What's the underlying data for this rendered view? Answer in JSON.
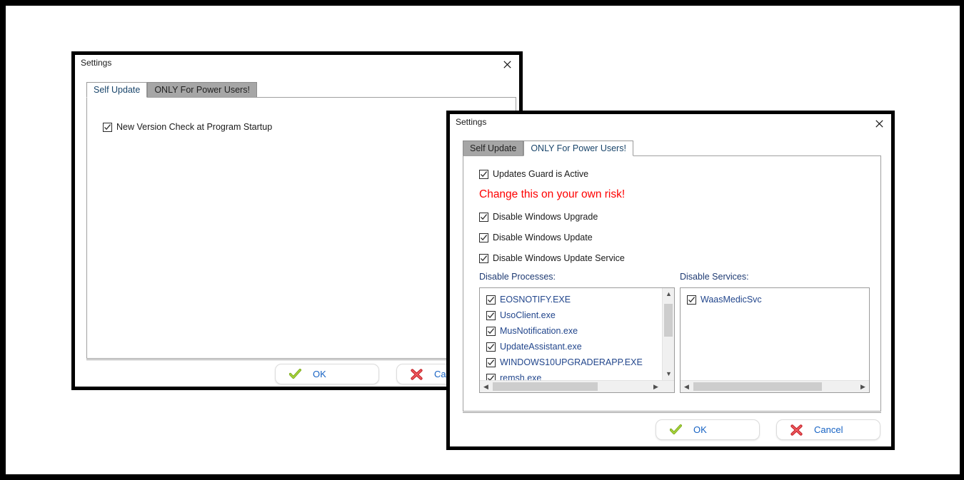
{
  "app": {
    "window_title": "Settings"
  },
  "dialog_self_update": {
    "title": "Settings",
    "close_icon": "close-icon",
    "tabs": [
      {
        "label": "Self Update",
        "active": true
      },
      {
        "label": "ONLY For Power Users!",
        "active": false
      }
    ],
    "options": [
      {
        "label": "New Version Check at Program Startup",
        "checked": true
      }
    ],
    "buttons": [
      {
        "label": "OK",
        "icon": "green-check-icon"
      },
      {
        "label": "Cancel",
        "icon": "red-x-icon"
      }
    ]
  },
  "dialog_power_users": {
    "title": "Settings",
    "close_icon": "close-icon",
    "tabs": [
      {
        "label": "Self Update",
        "active": false
      },
      {
        "label": "ONLY For Power Users!",
        "active": true
      }
    ],
    "guard_option": {
      "label": "Updates Guard is Active",
      "checked": true
    },
    "warning": "Change this on your own risk!",
    "toggles": [
      {
        "label": "Disable Windows Upgrade",
        "checked": true
      },
      {
        "label": "Disable Windows Update",
        "checked": true
      },
      {
        "label": "Disable Windows Update Service",
        "checked": true
      }
    ],
    "processes": {
      "label": "Disable Processes:",
      "items": [
        {
          "label": "EOSNOTIFY.EXE",
          "checked": true
        },
        {
          "label": "UsoClient.exe",
          "checked": true
        },
        {
          "label": "MusNotification.exe",
          "checked": true
        },
        {
          "label": "UpdateAssistant.exe",
          "checked": true
        },
        {
          "label": "WINDOWS10UPGRADERAPP.EXE",
          "checked": true
        },
        {
          "label": "remsh.exe",
          "checked": true
        }
      ]
    },
    "services": {
      "label": "Disable Services:",
      "items": [
        {
          "label": "WaasMedicSvc",
          "checked": true
        }
      ]
    },
    "buttons": [
      {
        "label": "OK",
        "icon": "green-check-icon"
      },
      {
        "label": "Cancel",
        "icon": "red-x-icon"
      }
    ]
  },
  "colors": {
    "warning_red": "#fe0000",
    "link_blue": "#1763c4",
    "list_text_blue": "#22468c",
    "section_label_blue": "#1f3b73",
    "tab_inactive": "#a6a6a6"
  }
}
